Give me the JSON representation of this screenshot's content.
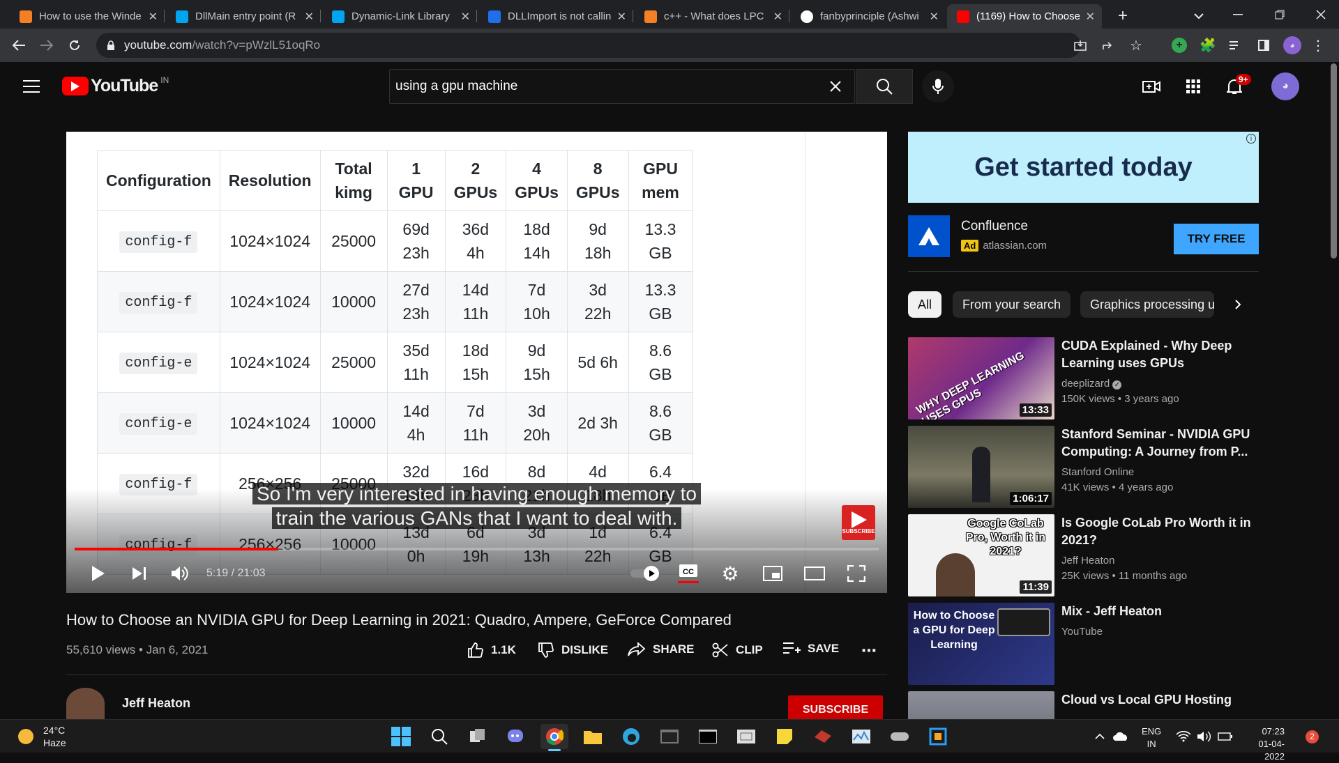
{
  "browser": {
    "tabs": [
      {
        "title": "How to use the Winde",
        "icon_color": "#f48024",
        "icon": "stackoverflow-icon"
      },
      {
        "title": "DllMain entry point (R",
        "icon_color": "#00a4ef",
        "icon": "microsoft-icon"
      },
      {
        "title": "Dynamic-Link Library",
        "icon_color": "#00a4ef",
        "icon": "microsoft-icon"
      },
      {
        "title": "DLLImport is not callin",
        "icon_color": "#1f6feb",
        "icon": "msdn-icon"
      },
      {
        "title": "c++ - What does LPC",
        "icon_color": "#f48024",
        "icon": "stackoverflow-icon"
      },
      {
        "title": "fanbyprinciple (Ashwi",
        "icon_color": "#ffffff",
        "icon": "github-icon"
      },
      {
        "title": "(1169) How to Choose",
        "icon_color": "#ff0000",
        "icon": "youtube-icon"
      }
    ],
    "url_host": "youtube.com",
    "url_path": "/watch?v=pWzlL51oqRo"
  },
  "youtube": {
    "logo_text": "YouTube",
    "region": "IN",
    "search_value": "using a gpu machine",
    "notifications": "9+"
  },
  "player": {
    "table_headers": [
      "Configuration",
      "Resolution",
      "Total kimg",
      "1 GPU",
      "2 GPUs",
      "4 GPUs",
      "8 GPUs",
      "GPU mem"
    ],
    "table_rows": [
      [
        "config-f",
        "1024×1024",
        "25000",
        "69d 23h",
        "36d 4h",
        "18d 14h",
        "9d 18h",
        "13.3 GB"
      ],
      [
        "config-f",
        "1024×1024",
        "10000",
        "27d 23h",
        "14d 11h",
        "7d 10h",
        "3d 22h",
        "13.3 GB"
      ],
      [
        "config-e",
        "1024×1024",
        "25000",
        "35d 11h",
        "18d 15h",
        "9d 15h",
        "5d 6h",
        "8.6 GB"
      ],
      [
        "config-e",
        "1024×1024",
        "10000",
        "14d 4h",
        "7d 11h",
        "3d 20h",
        "2d 3h",
        "8.6 GB"
      ],
      [
        "config-f",
        "256×256",
        "25000",
        "32d 13h",
        "16d 23h",
        "8d 21h",
        "4d 18h",
        "6.4 GB"
      ],
      [
        "config-f",
        "256×256",
        "10000",
        "13d 0h",
        "6d 19h",
        "3d 13h",
        "1d 22h",
        "6.4 GB"
      ]
    ],
    "caption_line1": "So I'm very interested in having enough memory to",
    "caption_line2": "train the various GANs that I want to deal with.",
    "time": "5:19 / 21:03",
    "progress_fraction": 0.253,
    "subscribe_watermark": "SUBSCRIBE"
  },
  "video": {
    "title": "How to Choose an NVIDIA GPU for Deep Learning in 2021: Quadro, Ampere, GeForce Compared",
    "meta": "55,610 views • Jan 6, 2021",
    "likes": "1.1K",
    "dislike": "DISLIKE",
    "share": "SHARE",
    "clip": "CLIP",
    "save": "SAVE",
    "channel": "Jeff Heaton",
    "subscribe": "SUBSCRIBE"
  },
  "ad": {
    "banner_text": "Get started today",
    "advertiser": "Confluence",
    "badge": "Ad",
    "domain": "atlassian.com",
    "cta": "TRY FREE"
  },
  "chips": [
    "All",
    "From your search",
    "Graphics processing u"
  ],
  "recommendations": [
    {
      "title": "CUDA Explained - Why Deep Learning uses GPUs",
      "channel": "deeplizard",
      "stats": "150K views • 3 years ago",
      "duration": "13:33",
      "thumb_text": "WHY DEEP LEARNING USES GPUS"
    },
    {
      "title": "Stanford Seminar - NVIDIA GPU Computing: A Journey from P...",
      "channel": "Stanford Online",
      "stats": "41K views • 4 years ago",
      "duration": "1:06:17",
      "thumb_text": ""
    },
    {
      "title": "Is Google CoLab Pro Worth it in 2021?",
      "channel": "Jeff Heaton",
      "stats": "25K views • 11 months ago",
      "duration": "11:39",
      "thumb_text": "Google CoLab Pro, Worth it in 2021?"
    },
    {
      "title": "Mix - Jeff Heaton",
      "channel": "YouTube",
      "stats": "",
      "duration": "",
      "thumb_text": "How to Choose a GPU for Deep Learning"
    },
    {
      "title": "Cloud vs Local GPU Hosting",
      "channel": "",
      "stats": "",
      "duration": "",
      "thumb_text": ""
    }
  ],
  "taskbar": {
    "temp": "24°C",
    "weather": "Haze",
    "lang1": "ENG",
    "lang2": "IN",
    "time": "07:23",
    "date": "01-04-2022",
    "badge": "2"
  }
}
